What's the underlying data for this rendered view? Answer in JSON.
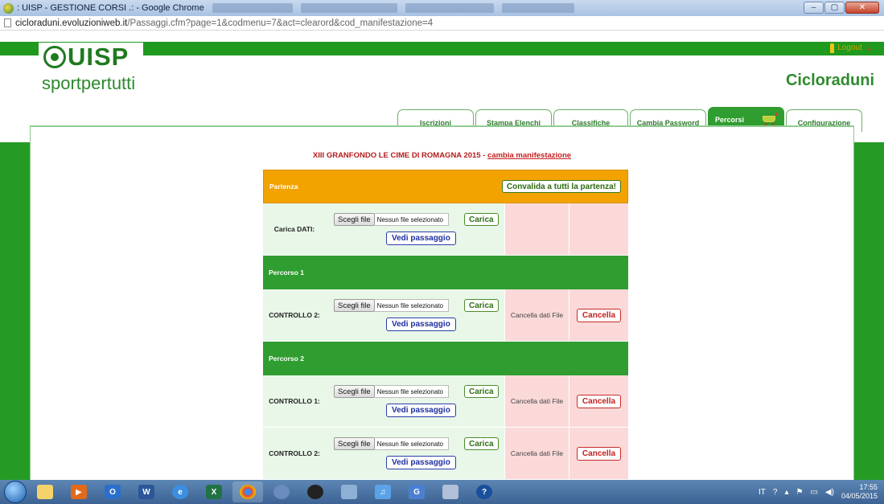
{
  "window": {
    "title": ": UISP - GESTIONE CORSI .: - Google Chrome",
    "controls": [
      "–",
      "▢",
      "✕"
    ]
  },
  "urlbar": {
    "host": "cicloraduni.evoluzioniweb.it",
    "path": "/Passaggi.cfm?page=1&codmenu=7&act=clearord&cod_manifestazione=4"
  },
  "header": {
    "logo_main": "UISP",
    "logo_tagline": "sportpertutti",
    "logout": "Logout",
    "app_name": "Cicloraduni"
  },
  "tabs": [
    {
      "label": "Iscrizioni",
      "active": false
    },
    {
      "label": "Stampa Elenchi",
      "active": false
    },
    {
      "label": "Classifiche",
      "active": false
    },
    {
      "label": "Cambia Password",
      "active": false
    },
    {
      "label": "Percorsi",
      "active": true
    },
    {
      "label": "Configurazione",
      "active": false
    }
  ],
  "event": {
    "title": "XIII GRANFONDO LE CIME DI ROMAGNA 2015 - ",
    "change_link": "cambia manifestazione"
  },
  "grid": {
    "partenza_label": "Partenza",
    "convalida_label": "Convalida a tutti la partenza!",
    "choose_file_label": "Scegli file",
    "no_file_label": "Nessun file selezionato",
    "carica_label": "Carica",
    "vedi_label": "Vedi passaggio",
    "cancella_dati_label": "Cancella dati File",
    "cancella_label": "Cancella",
    "carica_dati_label": "Carica DATI:",
    "percorso1": "Percorso 1",
    "percorso1_controllo2": "CONTROLLO 2:",
    "percorso2": "Percorso 2",
    "percorso2_controllo1": "CONTROLLO 1:",
    "percorso2_controllo2": "CONTROLLO 2:"
  },
  "taskbar": {
    "items": [
      "folder",
      "media-player",
      "outlook",
      "word",
      "internet-explorer",
      "excel",
      "chrome",
      "app-1",
      "app-2",
      "app-3",
      "music",
      "app-g",
      "app-4",
      "help"
    ],
    "language": "IT",
    "time": "17:55",
    "date": "04/05/2015"
  }
}
